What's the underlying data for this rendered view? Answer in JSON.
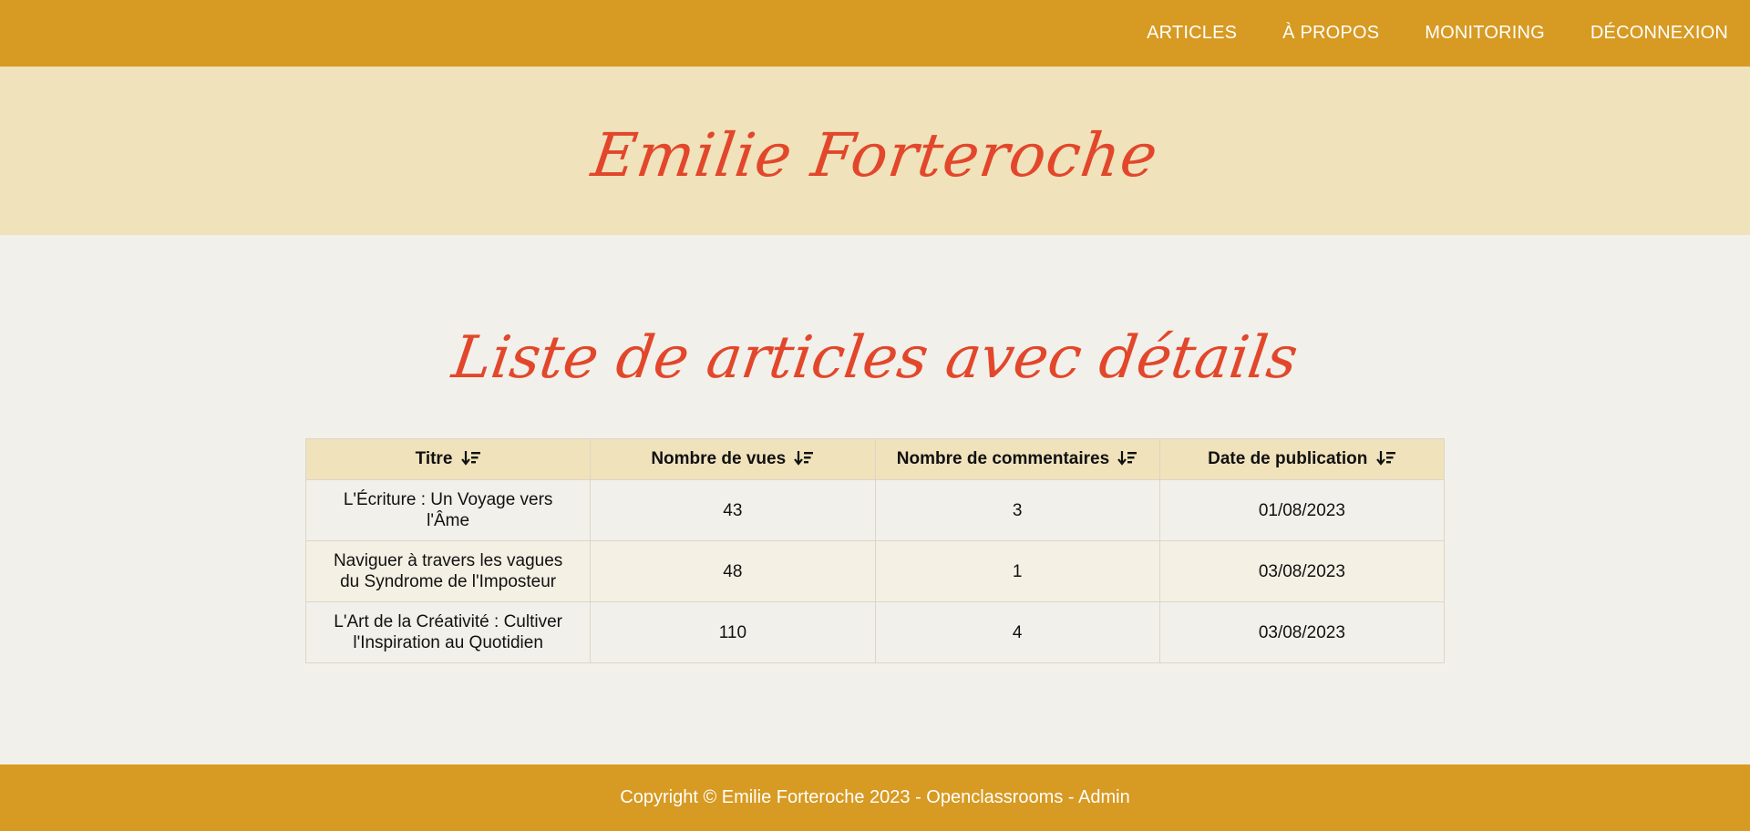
{
  "nav": {
    "items": [
      "ARTICLES",
      "À PROPOS",
      "MONITORING",
      "DÉCONNEXION"
    ]
  },
  "hero": {
    "brand": "Emilie Forteroche"
  },
  "main": {
    "title": "Liste de articles avec détails",
    "table": {
      "headers": [
        "Titre",
        "Nombre de vues",
        "Nombre de commentaires",
        "Date de publication"
      ],
      "sort_icon": "sort-down-icon",
      "rows": [
        [
          "L'Écriture : Un Voyage vers l'Âme",
          "43",
          "3",
          "01/08/2023"
        ],
        [
          "Naviguer à travers les vagues du Syndrome de l'Imposteur",
          "48",
          "1",
          "03/08/2023"
        ],
        [
          "L'Art de la Créativité : Cultiver l'Inspiration au Quotidien",
          "110",
          "4",
          "03/08/2023"
        ]
      ]
    }
  },
  "footer": {
    "copyright": "Copyright © Emilie Forteroche 2023 - Openclassrooms - Admin"
  },
  "colors": {
    "accent": "#D79A22",
    "hero_bg": "#F0E2BB",
    "brand_red": "#E2472B",
    "page_bg": "#F2F0EA"
  }
}
